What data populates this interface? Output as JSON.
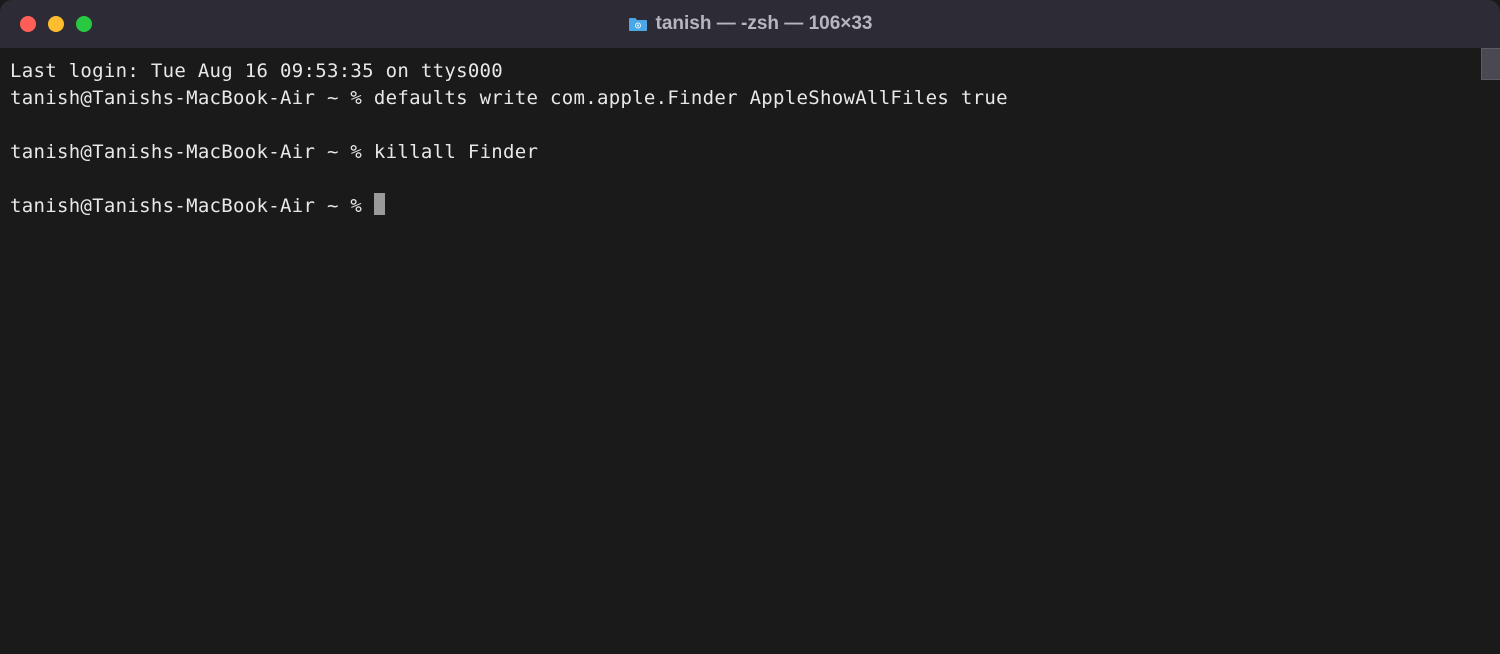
{
  "titlebar": {
    "title": "tanish — -zsh — 106×33",
    "folder_icon": "folder-icon"
  },
  "terminal": {
    "last_login": "Last login: Tue Aug 16 09:53:35 on ttys000",
    "lines": [
      {
        "prompt": "tanish@Tanishs-MacBook-Air ~ % ",
        "command": "defaults write com.apple.Finder AppleShowAllFiles true"
      },
      {
        "prompt": "tanish@Tanishs-MacBook-Air ~ % ",
        "command": "killall Finder"
      },
      {
        "prompt": "tanish@Tanishs-MacBook-Air ~ % ",
        "command": ""
      }
    ]
  }
}
